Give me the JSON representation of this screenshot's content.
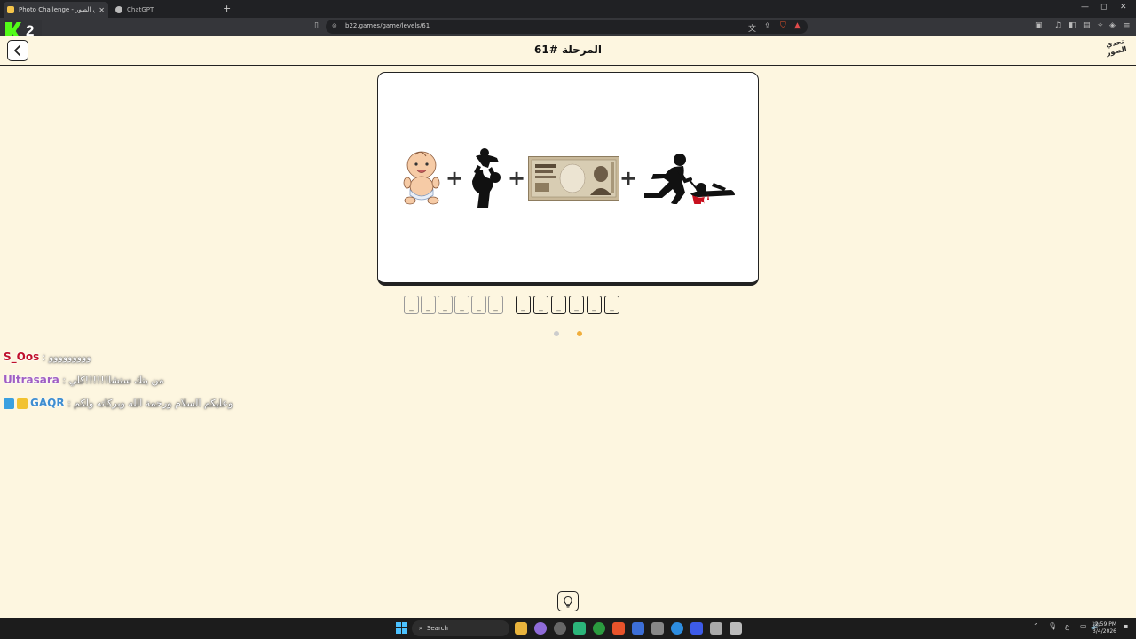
{
  "browser": {
    "tabs": [
      {
        "title": "Photo Challenge - تحدي الصور",
        "active": true
      },
      {
        "title": "ChatGPT",
        "active": false
      }
    ],
    "new_tab_label": "+",
    "url": "b22.games/game/levels/61",
    "window_controls": {
      "minimize": "—",
      "maximize": "◻",
      "close": "✕"
    }
  },
  "overlay": {
    "viewer_count": "2"
  },
  "header": {
    "title": "المرحلة #61",
    "logo_text": "تحدي الصور"
  },
  "puzzle": {
    "plus": "+",
    "images": [
      "baby-icon",
      "parent-lifting-child-icon",
      "yen-banknote-icon",
      "attacker-stabbing-victim-icon"
    ]
  },
  "answer": {
    "slot_char": "_",
    "word1_length": 6,
    "word2_length": 6
  },
  "chat": [
    {
      "user": "S_Oos",
      "sep": " : ",
      "message": "ووووووووو",
      "color": "#c0102b"
    },
    {
      "user": "Ultrasara",
      "sep": " : ",
      "message": "من يتك ستشا!!!!!!كلي",
      "color": "#a05fc4"
    },
    {
      "user": "GAQR",
      "sep": " : ",
      "message": "وعليكم السلام ورحمة الله وبركاته ولكم",
      "color": "#3f8ed1"
    }
  ],
  "taskbar": {
    "search_label": "Search",
    "time": "12:59 PM",
    "date": "3/4/2026",
    "lang": "ع"
  },
  "colors": {
    "page_bg": "#fdf6e0",
    "dot_inactive": "#cccccc",
    "dot_active": "#f0ad3b"
  }
}
